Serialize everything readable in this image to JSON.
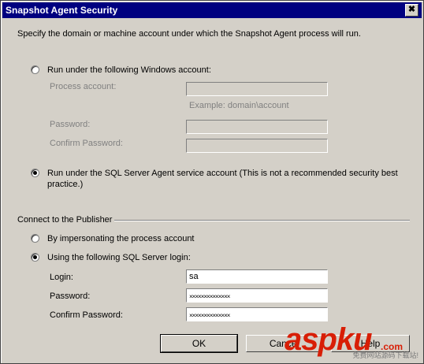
{
  "window": {
    "title": "Snapshot Agent Security",
    "close_glyph": "✖"
  },
  "intro": "Specify the domain or machine account under which the Snapshot Agent process will run.",
  "process_section": {
    "option_windows_account": "Run under the following Windows account:",
    "process_account_label": "Process account:",
    "process_account_value": "",
    "example_text": "Example: domain\\account",
    "password_label": "Password:",
    "password_value": "",
    "confirm_password_label": "Confirm Password:",
    "confirm_password_value": "",
    "option_agent_account": "Run under the SQL Server Agent service account (This is not a recommended security best practice.)"
  },
  "publisher_section": {
    "group_title": "Connect to the Publisher",
    "option_impersonate": "By impersonating the process account",
    "option_sql_login": "Using the following SQL Server login:",
    "login_label": "Login:",
    "login_value": "sa",
    "password_label": "Password:",
    "password_value": "××××××××××××××",
    "confirm_password_label": "Confirm Password:",
    "confirm_password_value": "××××××××××××××"
  },
  "buttons": {
    "ok": "OK",
    "cancel": "Cancel",
    "help": "Help"
  },
  "watermark": {
    "brand": "aspku",
    "suffix": ".com",
    "tagline": "免费网站源码下载站!"
  },
  "colors": {
    "titlebar": "#000080",
    "face": "#d4d0c8",
    "watermark": "#d81e06"
  }
}
